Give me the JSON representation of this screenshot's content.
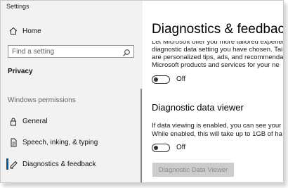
{
  "window": {
    "title": "Settings"
  },
  "sidebar": {
    "home_label": "Home",
    "search_placeholder": "Find a setting",
    "section_title": "Privacy",
    "group_title": "Windows permissions",
    "items": [
      {
        "label": "General",
        "icon": "lock-icon"
      },
      {
        "label": "Speech, inking, & typing",
        "icon": "document-icon"
      },
      {
        "label": "Diagnostics & feedback",
        "icon": "feedback-icon",
        "selected": true
      }
    ],
    "accent_color": "#005a9e"
  },
  "main": {
    "title": "Diagnostics & feedback",
    "description_lines": [
      "Let Microsoft offer you more tailored experiences",
      "diagnostic data setting you have chosen. Tai",
      "are personalized tips, ads, and recommenda",
      "Microsoft products and services for your ne"
    ],
    "tailored_toggle": {
      "state": "Off"
    },
    "viewer_heading": "Diagnostic data viewer",
    "viewer_lines": [
      "If data viewing is enabled, you can see your",
      "While enabled, this will take up to 1GB of ha"
    ],
    "viewer_toggle": {
      "state": "Off"
    },
    "viewer_button_label": "Diagnostic Data Viewer"
  }
}
